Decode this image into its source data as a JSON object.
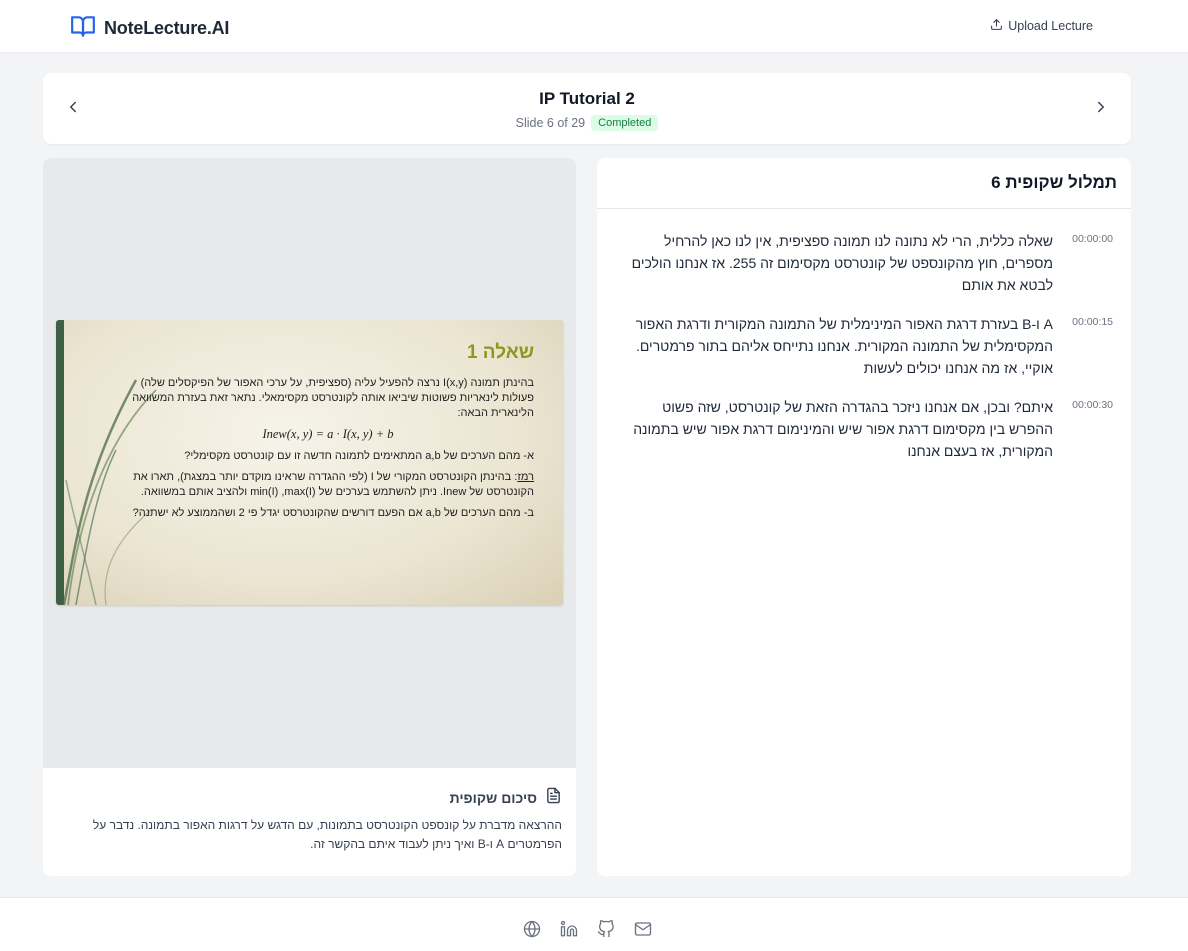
{
  "header": {
    "brand": "NoteLecture.AI",
    "upload_label": "Upload Lecture"
  },
  "nav": {
    "title": "IP Tutorial 2",
    "slide_counter": "Slide 6 of 29",
    "status": "Completed"
  },
  "slide": {
    "title": "שאלה 1",
    "intro": "בהינתן תמונה I(x,y) נרצה להפעיל עליה (ספציפית, על ערכי האפור של הפיקסלים שלה) פעולות לינאריות פשוטות שיביאו אותה לקונטרסט מקסימאלי. נתאר זאת בעזרת המשוואה הלינארית הבאה:",
    "formula": "Inew(x, y) = a · I(x, y) + b",
    "part_a": "א-   מהם הערכים של a,b המתאימים לתמונה חדשה זו עם קונטרסט מקסימלי?",
    "hint_label": "רמז",
    "hint": ": בהינתן הקונטרסט המקורי של I (לפי ההגדרה שראינו מוקדם יותר במצגת), תארו את הקונטרסט של Inew. ניתן להשתמש בערכים של min(I) ,max(I) ולהציב אותם במשוואה.",
    "part_b": "ב-   מהם הערכים של a,b אם הפעם דורשים שהקונטרסט יגדל פי 2 ושהממוצע לא ישתנה?"
  },
  "summary": {
    "title": "סיכום שקופית",
    "text": "ההרצאה מדברת על קונספט הקונטרסט בתמונות, עם הדגש על דרגות האפור בתמונה. נדבר על הפרמטרים A ו-B ואיך ניתן לעבוד איתם בהקשר זה."
  },
  "transcript": {
    "title": "תמלול שקופית 6",
    "entries": [
      {
        "time": "00:00:00",
        "text": "שאלה כללית, הרי לא נתונה לנו תמונה ספציפית, אין לנו כאן להרחיל מספרים, חוץ מהקונספט של קונטרסט מקסימום זה 255. אז אנחנו הולכים לבטא את אותם"
      },
      {
        "time": "00:00:15",
        "text": "A ו-B בעזרת דרגת האפור המינימלית של התמונה המקורית ודרגת האפור המקסימלית של התמונה המקורית. אנחנו נתייחס אליהם בתור פרמטרים. אוקיי, אז מה אנחנו יכולים לעשות"
      },
      {
        "time": "00:00:30",
        "text": "איתם? ובכן, אם אנחנו ניזכר בהגדרה הזאת של קונטרסט, שזה פשוט ההפרש בין מקסימום דרגת אפור שיש והמינימום דרגת אפור שיש בתמונה המקורית, אז בעצם אנחנו"
      }
    ]
  },
  "footer": {
    "icons": [
      "globe-icon",
      "linkedin-icon",
      "github-icon",
      "mail-icon"
    ]
  },
  "colors": {
    "accent": "#2563eb",
    "badge_bg": "#dcfce7",
    "badge_text": "#15803d",
    "slide_title": "#8a9a1f"
  }
}
